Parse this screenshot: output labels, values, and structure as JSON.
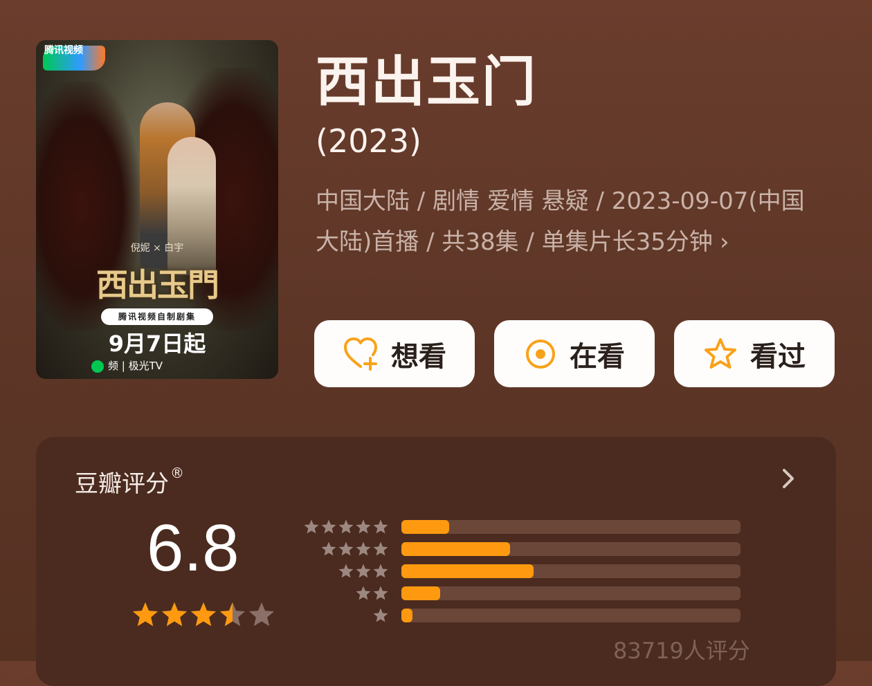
{
  "poster": {
    "brand": "腾讯视频",
    "cast": "倪妮 × 白宇",
    "title": "西出玉門",
    "badge": "腾讯视频自制剧集",
    "date": "9月7日起",
    "footer": "频 | 极光TV"
  },
  "show": {
    "title": "西出玉门",
    "year": "(2023)",
    "meta": "中国大陆 / 剧情 爱情 悬疑 / 2023-09-07(中国大陆)首播 / 共38集 / 单集片长35分钟",
    "meta_chevron": "›"
  },
  "actions": {
    "want": "想看",
    "watching": "在看",
    "watched": "看过"
  },
  "colors": {
    "accent": "#ff9a10",
    "background": "#5f3828",
    "card": "#4b2b1f"
  },
  "rating": {
    "label": "豆瓣评分",
    "registered": "®",
    "score": "6.8",
    "stars_out_of_5": 3.5,
    "distribution": [
      {
        "stars": 5,
        "fraction": 0.14
      },
      {
        "stars": 4,
        "fraction": 0.32
      },
      {
        "stars": 3,
        "fraction": 0.39
      },
      {
        "stars": 2,
        "fraction": 0.115
      },
      {
        "stars": 1,
        "fraction": 0.033
      }
    ],
    "count_text": "83719人评分"
  }
}
